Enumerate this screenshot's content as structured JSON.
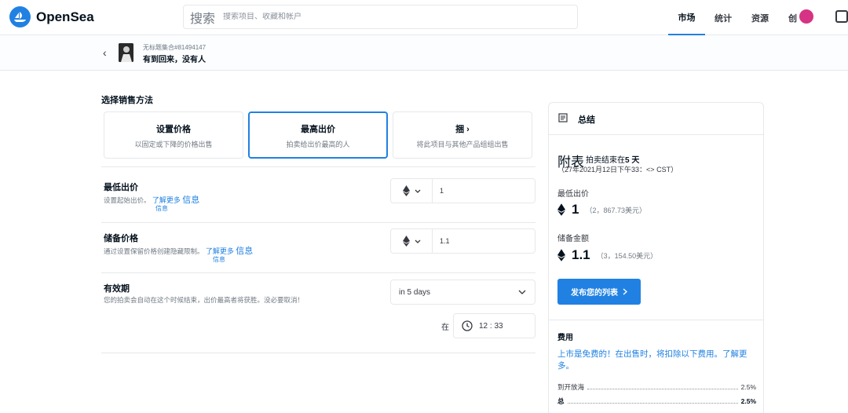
{
  "header": {
    "brand": "OpenSea",
    "search_label": "搜索",
    "search_placeholder": "搜索项目、收藏和帐户",
    "nav": [
      {
        "label": "市场"
      },
      {
        "label": "统计"
      },
      {
        "label": "资源"
      },
      {
        "label": "创"
      }
    ],
    "accent_color": "#2081e2"
  },
  "item": {
    "back_glyph": "‹",
    "collection": "无标题集合#81494147",
    "name": "有到回来，没有人"
  },
  "sell": {
    "section_title": "选择销售方法",
    "methods": [
      {
        "title": "设置价格",
        "desc": "以固定或下降的价格出售"
      },
      {
        "title": "最高出价",
        "desc": "拍卖给出价最高的人"
      },
      {
        "title": "捆 ›",
        "desc": "将此项目与其他产品组组出售"
      }
    ],
    "min_bid": {
      "title": "最低出价",
      "desc": "设置起始出价。",
      "learn": "了解更多",
      "info": "信息",
      "info_sub": "信息",
      "currency": "ETH",
      "value": "1"
    },
    "reserve": {
      "title": "储备价格",
      "desc": "通过设置保留价格创建隐藏限制。",
      "learn": "了解更多",
      "info": "信息",
      "info_sub": "信息",
      "currency": "ETH",
      "value": "1.1"
    },
    "expiration": {
      "title": "有效期",
      "desc": "您的拍卖会自动在这个时候结束，出价最高者将获胜。没必要取消！",
      "selected": "in 5 days",
      "at_label": "在",
      "time": "12 : 33"
    }
  },
  "summary": {
    "title": "总结",
    "listing_big": "附表",
    "listing_note_prefix": "拍卖结束在",
    "listing_note_bold": "5 天",
    "listing_date": "（27年2021月12日下午33：<> CST）",
    "min_label": "最低出价",
    "min_amount": "1",
    "min_usd": "（2，867.73美元）",
    "reserve_label": "储备金额",
    "reserve_amount": "1.1",
    "reserve_usd": "（3，154.50美元）",
    "post_button": "发布您的列表",
    "fees_title": "费用",
    "fees_text": "上市是免费的！在出售时，将扣除以下费用。",
    "fees_link": "了解更多。",
    "fee_rows": [
      {
        "label": "到开放海",
        "value": "2.5%"
      },
      {
        "label": "总",
        "value": "2.5%"
      }
    ]
  }
}
